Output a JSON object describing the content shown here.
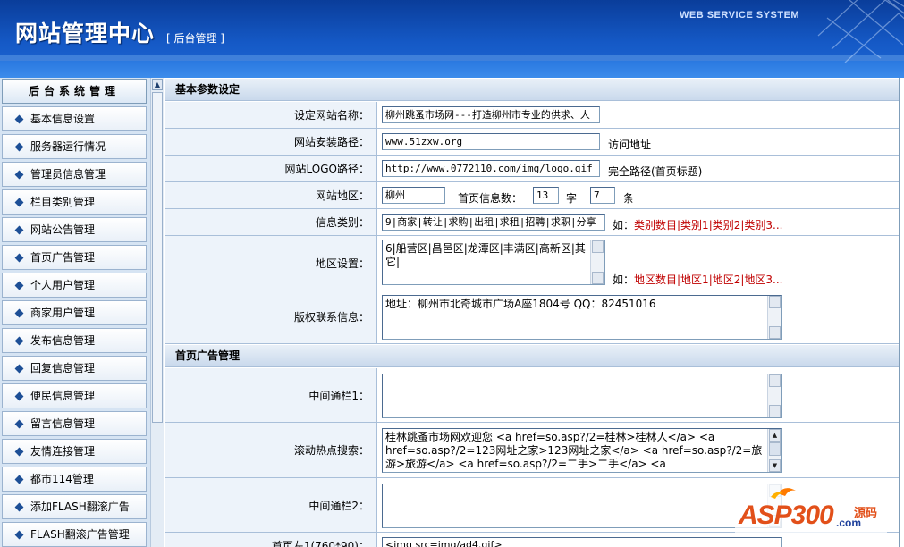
{
  "header": {
    "title": "网站管理中心",
    "subtitle": "[ 后台管理 ]",
    "system_label": "WEB SERVICE SYSTEM"
  },
  "sidebar": {
    "title": "后台系统管理",
    "items": [
      {
        "label": "基本信息设置"
      },
      {
        "label": "服务器运行情况"
      },
      {
        "label": "管理员信息管理"
      },
      {
        "label": "栏目类别管理"
      },
      {
        "label": "网站公告管理"
      },
      {
        "label": "首页广告管理"
      },
      {
        "label": "个人用户管理"
      },
      {
        "label": "商家用户管理"
      },
      {
        "label": "发布信息管理"
      },
      {
        "label": "回复信息管理"
      },
      {
        "label": "便民信息管理"
      },
      {
        "label": "留言信息管理"
      },
      {
        "label": "友情连接管理"
      },
      {
        "label": "都市114管理"
      },
      {
        "label": "添加FLASH翻滚广告"
      },
      {
        "label": "FLASH翻滚广告管理"
      }
    ]
  },
  "form": {
    "section_basic": "基本参数设定",
    "site_name": {
      "label": "设定网站名称：",
      "value": "柳州跳蚤市场网---打造柳州市专业的供求、人"
    },
    "site_path": {
      "label": "网站安装路径：",
      "value": "www.51zxw.org",
      "note": "访问地址"
    },
    "logo_path": {
      "label": "网站LOGO路径：",
      "value": "http://www.0772110.com/img/logo.gif",
      "note": "完全路径(首页标题)"
    },
    "region": {
      "label": "网站地区：",
      "value": "柳州",
      "count_label": "首页信息数：",
      "count1": "13",
      "unit1": "字",
      "count2": "7",
      "unit2": "条"
    },
    "categories": {
      "label": "信息类别：",
      "value": "9|商家|转让|求购|出租|求租|招聘|求职|分享",
      "hint_prefix": "如：",
      "hint": "类别数目|类别1|类别2|类别3..."
    },
    "areas": {
      "label": "地区设置：",
      "value": "6|船营区|昌邑区|龙潭区|丰满区|高新区|其它|",
      "hint_prefix": "如：",
      "hint": "地区数目|地区1|地区2|地区3..."
    },
    "copyright": {
      "label": "版权联系信息：",
      "value": "地址：柳州市北奇城市广场A座1804号  QQ：82451016"
    },
    "section_ads": "首页广告管理",
    "mid_bar1": {
      "label": "中间通栏1：",
      "value": ""
    },
    "scroll_hot": {
      "label": "滚动热点搜索：",
      "value": "桂林跳蚤市场网欢迎您 <a href=so.asp?/2=桂林>桂林人</a> <a href=so.asp?/2=123网址之家>123网址之家</a> <a href=so.asp?/2=旅游>旅游</a>  <a href=so.asp?/2=二手>二手</a> <a"
    },
    "mid_bar2": {
      "label": "中间通栏2：",
      "value": ""
    },
    "left_ad": {
      "label": "首页左1(760*90)：",
      "value": "<img src=img/ad4.gif>"
    }
  },
  "watermark": {
    "brand": "ASP300",
    "tag": "源码",
    "domain": ".com"
  },
  "colors": {
    "header_blue": "#1559c6",
    "row_label_bg": "#edf3fa",
    "hint_red": "#c00000"
  }
}
